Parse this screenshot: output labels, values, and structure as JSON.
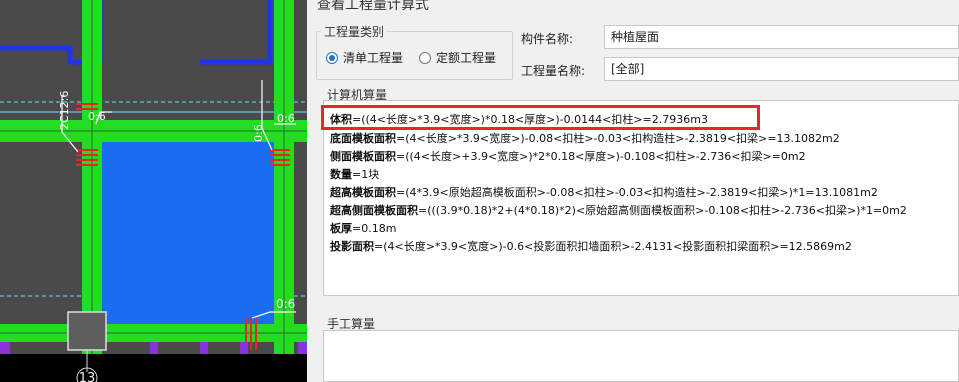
{
  "cad": {
    "axis_number": "13",
    "dims": {
      "d1": "2C12:6",
      "d2": "0:6",
      "d3": "0:6",
      "d4": "0:6",
      "d5": "0:6"
    }
  },
  "dialog": {
    "title": "查看工程量计算式",
    "qty_type_group": "工程量类别",
    "radio_list": "清单工程量",
    "radio_quota": "定额工程量",
    "component_label": "构件名称:",
    "component_value": "种植屋面",
    "qty_name_label": "工程量名称:",
    "qty_name_value": "[全部]",
    "calc_group": "计算机算量",
    "manual_group": "手工算量",
    "lines": [
      {
        "k": "体积",
        "v": "=((4<长度>*3.9<宽度>)*0.18<厚度>)-0.0144<扣柱>=2.7936m3"
      },
      {
        "k": "底面模板面积",
        "v": "=(4<长度>*3.9<宽度>)-0.08<扣柱>-0.03<扣构造柱>-2.3819<扣梁>=13.1082m2"
      },
      {
        "k": "侧面模板面积",
        "v": "=((4<长度>+3.9<宽度>)*2*0.18<厚度>)-0.108<扣柱>-2.736<扣梁>=0m2"
      },
      {
        "k": "数量",
        "v": "=1块"
      },
      {
        "k": "超高模板面积",
        "v": "=(4*3.9<原始超高模板面积>-0.08<扣柱>-0.03<扣构造柱>-2.3819<扣梁>)*1=13.1081m2"
      },
      {
        "k": "超高侧面模板面积",
        "v": "=(((3.9*0.18)*2+(4*0.18)*2)<原始超高侧面模板面积>-0.108<扣柱>-2.736<扣梁>)*1=0m2"
      },
      {
        "k": "板厚",
        "v": "=0.18m"
      },
      {
        "k": "投影面积",
        "v": "=(4<长度>*3.9<宽度>)-0.6<投影面积扣墙面积>-2.4131<投影面积扣梁面积>=12.5869m2"
      }
    ]
  },
  "colors": {
    "wall": "#22dd22",
    "slab": "#1a6cf0",
    "highlight": "#e8262b",
    "cad_bg": "#4a4a4a"
  }
}
